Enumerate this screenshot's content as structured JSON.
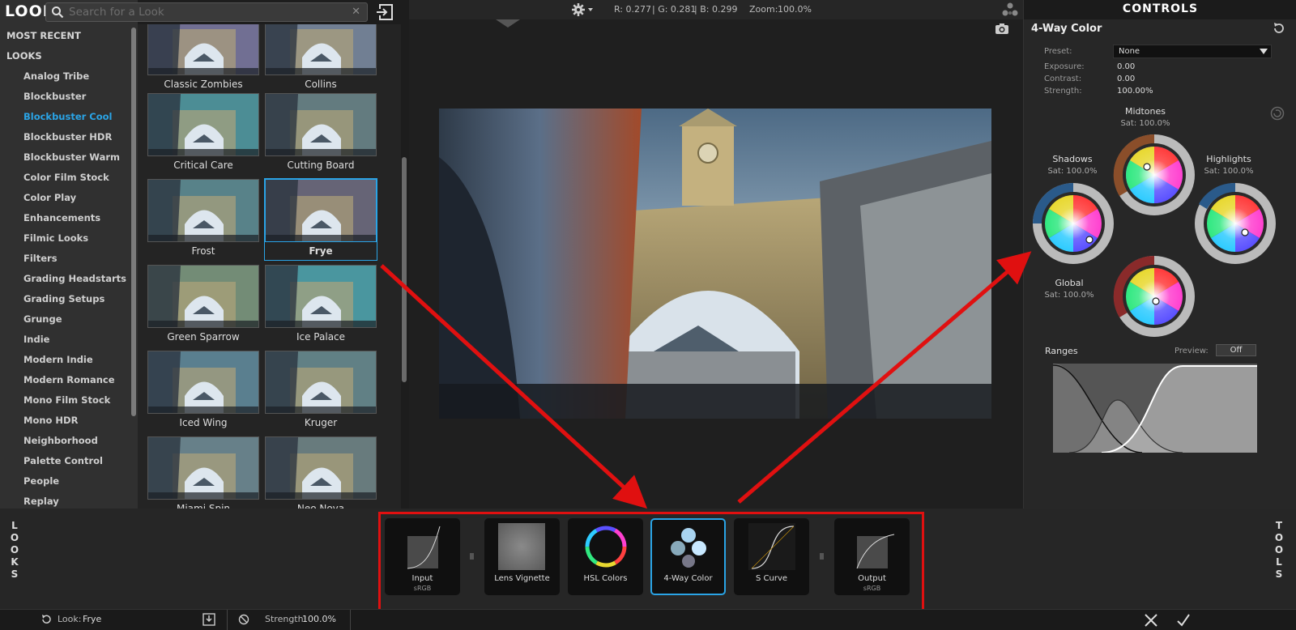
{
  "app": {
    "logo": "LOOKS"
  },
  "search": {
    "placeholder": "Search for a Look"
  },
  "categories": {
    "sections": [
      "MOST RECENT",
      "LOOKS"
    ],
    "items": [
      "Analog Tribe",
      "Blockbuster",
      "Blockbuster Cool",
      "Blockbuster HDR",
      "Blockbuster Warm",
      "Color Film Stock",
      "Color Play",
      "Enhancements",
      "Filmic Looks",
      "Filters",
      "Grading Headstarts",
      "Grading Setups",
      "Grunge",
      "Indie",
      "Modern Indie",
      "Modern Romance",
      "Mono Film Stock",
      "Mono HDR",
      "Neighborhood",
      "Palette Control",
      "People",
      "Replay"
    ],
    "active": "Blockbuster Cool"
  },
  "thumbnails": [
    "Classic Zombies",
    "Collins",
    "Critical Care",
    "Cutting Board",
    "Frost",
    "Frye",
    "Green Sparrow",
    "Ice Palace",
    "Iced Wing",
    "Kruger",
    "Miami Spin",
    "Neo Noya"
  ],
  "selected_look": "Frye",
  "toolbar": {
    "r": "R: 0.277",
    "g": "| G: 0.281",
    "b": "| B: 0.299",
    "zoom_label": "Zoom:",
    "zoom_value": "100.0%"
  },
  "controls": {
    "header": "CONTROLS",
    "tool_title": "4-Way Color",
    "preset_label": "Preset:",
    "preset_value": "None",
    "exposure_label": "Exposure:",
    "exposure_value": "0.00",
    "contrast_label": "Contrast:",
    "contrast_value": "0.00",
    "strength_label": "Strength:",
    "strength_value": "100.00%",
    "wheels": {
      "midtones": {
        "name": "Midtones",
        "sat": "Sat:  100.0%"
      },
      "shadows": {
        "name": "Shadows",
        "sat": "Sat:  100.0%"
      },
      "highlights": {
        "name": "Highlights",
        "sat": "Sat:  100.0%"
      },
      "global": {
        "name": "Global",
        "sat": "Sat:  100.0%"
      }
    },
    "ranges_label": "Ranges",
    "preview_label": "Preview:",
    "preview_value": "Off"
  },
  "side_tabs": {
    "looks": "L\nO\nO\nK\nS",
    "tools": "T\nO\nO\nL\nS"
  },
  "tools": [
    {
      "name": "Input",
      "sub": "sRGB"
    },
    {
      "name": "Lens Vignette",
      "sub": ""
    },
    {
      "name": "HSL Colors",
      "sub": ""
    },
    {
      "name": "4-Way Color",
      "sub": ""
    },
    {
      "name": "S Curve",
      "sub": ""
    },
    {
      "name": "Output",
      "sub": "sRGB"
    }
  ],
  "status": {
    "look_label": "Look:",
    "look_value": "Frye",
    "strength_label": "Strength:",
    "strength_value": "100.0%"
  },
  "colors": {
    "accent": "#2aa4e6",
    "annotation": "#e01010"
  }
}
